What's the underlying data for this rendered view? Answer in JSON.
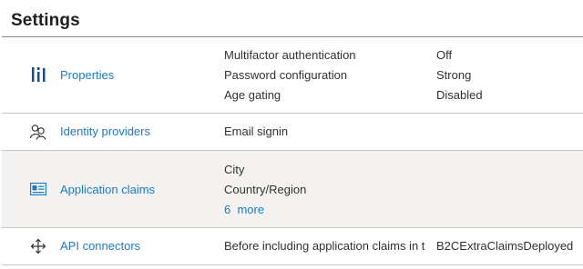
{
  "title": "Settings",
  "rows": {
    "properties": {
      "label": "Properties",
      "icon": "properties-icon",
      "items": [
        {
          "name": "Multifactor authentication",
          "value": "Off"
        },
        {
          "name": "Password configuration",
          "value": "Strong"
        },
        {
          "name": "Age gating",
          "value": "Disabled"
        }
      ]
    },
    "identity_providers": {
      "label": "Identity providers",
      "icon": "people-icon",
      "value": "Email signin"
    },
    "application_claims": {
      "label": "Application claims",
      "icon": "id-card-icon",
      "items": [
        "City",
        "Country/Region"
      ],
      "more": "6  more"
    },
    "api_connectors": {
      "label": "API connectors",
      "icon": "move-arrows-icon",
      "value": "Before including application claims in t",
      "value2": "B2CExtraClaimsDeployed"
    }
  },
  "colors": {
    "link": "#1b7ac7",
    "shaded_row": "#f3f2f1",
    "properties_icon": "#0f4c9a"
  }
}
